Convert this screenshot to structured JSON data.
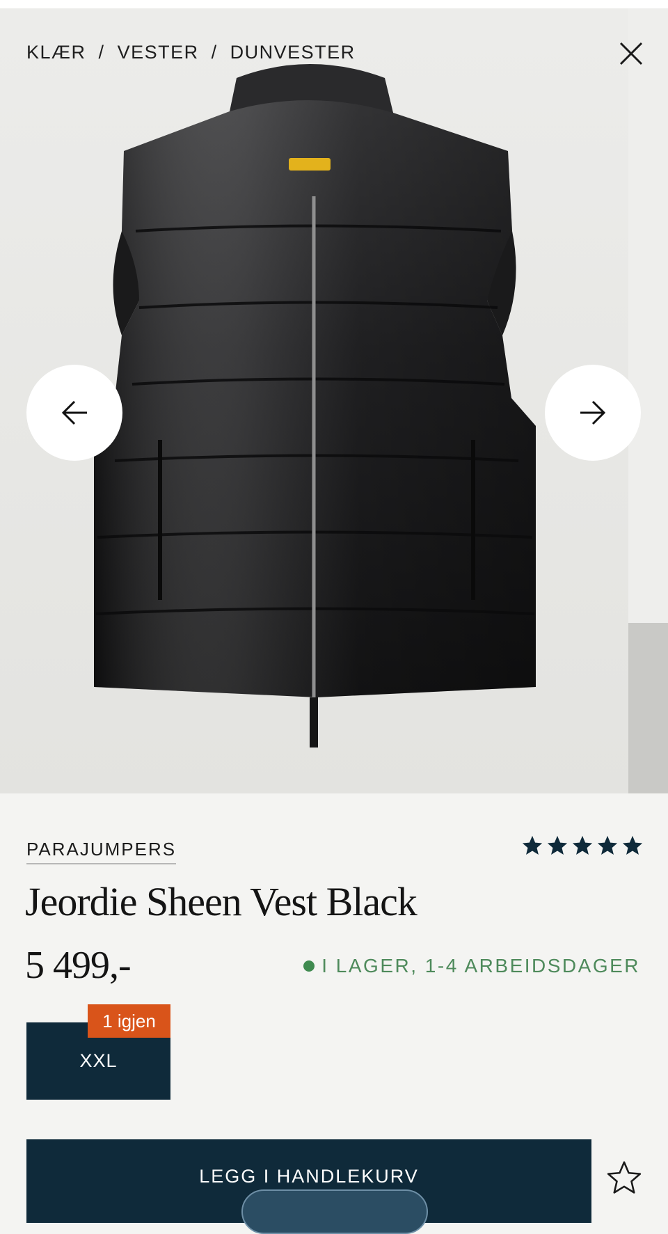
{
  "breadcrumb": {
    "items": [
      "KLÆR",
      "VESTER",
      "DUNVESTER"
    ],
    "separator": "/"
  },
  "gallery": {
    "image_alt": "Jeordie Sheen Vest Black",
    "prev_icon": "arrow-left-icon",
    "next_icon": "arrow-right-icon",
    "close_icon": "close-icon"
  },
  "product": {
    "brand": "PARAJUMPERS",
    "title": "Jeordie Sheen Vest Black",
    "price": "5 499,-",
    "rating": 5,
    "rating_max": 5,
    "stock_text": "I LAGER, 1-4 ARBEIDSDAGER",
    "stock_color": "#4e8a5b"
  },
  "sizes": [
    {
      "label": "XXL",
      "badge": "1 igjen",
      "selected": true
    }
  ],
  "actions": {
    "add_to_cart": "LEGG I HANDLEKURV",
    "wishlist_icon": "star-outline-icon"
  },
  "colors": {
    "primary": "#0f2a3a",
    "badge": "#d9541a",
    "background": "#f4f4f2"
  }
}
